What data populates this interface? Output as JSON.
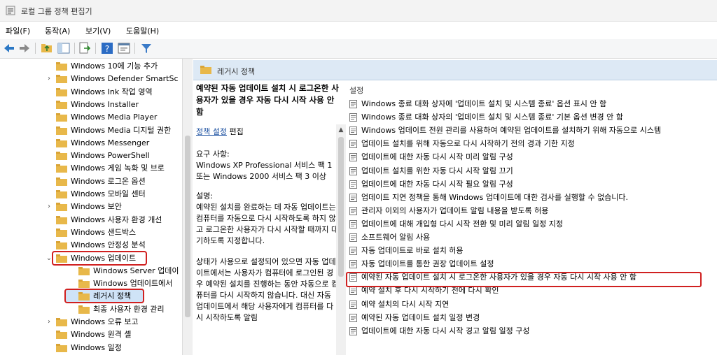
{
  "window": {
    "title": "로컬 그룹 정책 편집기"
  },
  "menu": [
    "파일(F)",
    "동작(A)",
    "보기(V)",
    "도움말(H)"
  ],
  "toolbar": {
    "icons": [
      "back-icon",
      "forward-icon",
      "up-folder-icon",
      "show-hide-tree-icon",
      "export-list-icon",
      "help-icon",
      "properties-icon",
      "filter-icon"
    ]
  },
  "tree": {
    "items": [
      {
        "label": "Windows 10에 기능 추가",
        "indent": 0,
        "arrow": ""
      },
      {
        "label": "Windows Defender SmartSc",
        "indent": 0,
        "arrow": "›"
      },
      {
        "label": "Windows Ink 작업 영역",
        "indent": 0,
        "arrow": ""
      },
      {
        "label": "Windows Installer",
        "indent": 0,
        "arrow": ""
      },
      {
        "label": "Windows Media Player",
        "indent": 0,
        "arrow": ""
      },
      {
        "label": "Windows Media 디지털 권한",
        "indent": 0,
        "arrow": ""
      },
      {
        "label": "Windows Messenger",
        "indent": 0,
        "arrow": ""
      },
      {
        "label": "Windows PowerShell",
        "indent": 0,
        "arrow": ""
      },
      {
        "label": "Windows 게임 녹화 및 브로",
        "indent": 0,
        "arrow": ""
      },
      {
        "label": "Windows 로그온 옵션",
        "indent": 0,
        "arrow": ""
      },
      {
        "label": "Windows 모바일 센터",
        "indent": 0,
        "arrow": ""
      },
      {
        "label": "Windows 보안",
        "indent": 0,
        "arrow": "›"
      },
      {
        "label": "Windows 사용자 환경 개선",
        "indent": 0,
        "arrow": ""
      },
      {
        "label": "Windows 샌드박스",
        "indent": 0,
        "arrow": ""
      },
      {
        "label": "Windows 안정성 분석",
        "indent": 0,
        "arrow": ""
      },
      {
        "label": "Windows 업데이트",
        "indent": 0,
        "arrow": "⌄"
      },
      {
        "label": "Windows Server 업데이",
        "indent": 1,
        "arrow": ""
      },
      {
        "label": "Windows 업데이트에서",
        "indent": 1,
        "arrow": ""
      },
      {
        "label": "레거시 정책",
        "indent": 1,
        "arrow": ""
      },
      {
        "label": "최종 사용자 환경 관리",
        "indent": 1,
        "arrow": ""
      },
      {
        "label": "Windows 오류 보고",
        "indent": 0,
        "arrow": "›"
      },
      {
        "label": "Windows 원격 셸",
        "indent": 0,
        "arrow": ""
      },
      {
        "label": "Windows 일정",
        "indent": 0,
        "arrow": ""
      }
    ]
  },
  "header": {
    "title": "레거시 정책"
  },
  "description": {
    "title": "예약된 자동 업데이트 설치 시 로그온한 사용자가 있을 경우 자동 다시 시작 사용 안 함",
    "edit_link": "정책 설정",
    "edit_suffix": " 편집",
    "req_label": "요구 사항:",
    "req_text": "Windows XP Professional 서비스 팩 1 또는 Windows 2000 서비스 팩 3 이상",
    "desc_label": "설명:",
    "desc_text": "예약된 설치를 완료하는 데 자동 업데이트는 컴퓨터를 자동으로 다시 시작하도록 하지 않고 로그온한 사용자가 다시 시작할 때까지 대기하도록 지정합니다.",
    "desc_text2": "상태가 사용으로 설정되어 있으면 자동 업데이트에서는 사용자가 컴퓨터에 로그인된 경우 예약된 설치를 진행하는 동안 자동으로 컴퓨터를 다시 시작하지 않습니다. 대신 자동 업데이트에서 해당 사용자에게 컴퓨터를 다시 시작하도록 알림"
  },
  "settings": {
    "head": "설정",
    "items": [
      "Windows 종료 대화 상자에 '업데이트 설치 및 시스템 종료' 옵션 표시 안 함",
      "Windows 종료 대화 상자의 '업데이트 설치 및 시스템 종료' 기본 옵션 변경 안 함",
      "Windows 업데이트 전원 관리를 사용하여 예약된 업데이트를 설치하기 위해 자동으로 시스템",
      "업데이트 설치를 위해 자동으로 다시 시작하기 전의 경과 기한 지정",
      "업데이트에 대한 자동 다시 시작 미리 알림 구성",
      "업데이트 설치를 위한 자동 다시 시작 알림 끄기",
      "업데이트에 대한 자동 다시 시작 필요 알림 구성",
      "업데이트 지연 정책을 통해 Windows 업데이트에 대한 검사를 실행할 수 없습니다.",
      "관리자 이외의 사용자가 업데이트 알림 내용을 받도록 허용",
      "업데이트에 대해 개입형 다시 시작 전환 및 미리 알림 일정 지정",
      "소프트웨어 알림 사용",
      "자동 업데이트로 바로 설치 허용",
      "자동 업데이트를 통한 권장 업데이트 설정",
      "예약된 자동 업데이트 설치 시 로그온한 사용자가 있을 경우 자동 다시 시작 사용 안 함",
      "예약 설치 후 다시 시작하기 전에 다시 확인",
      "예약 설치의 다시 시작 지연",
      "예약된 자동 업데이트 설치 일정 변경",
      "업데이트에 대한 자동 다시 시작 경고 알림 일정 구성"
    ]
  }
}
